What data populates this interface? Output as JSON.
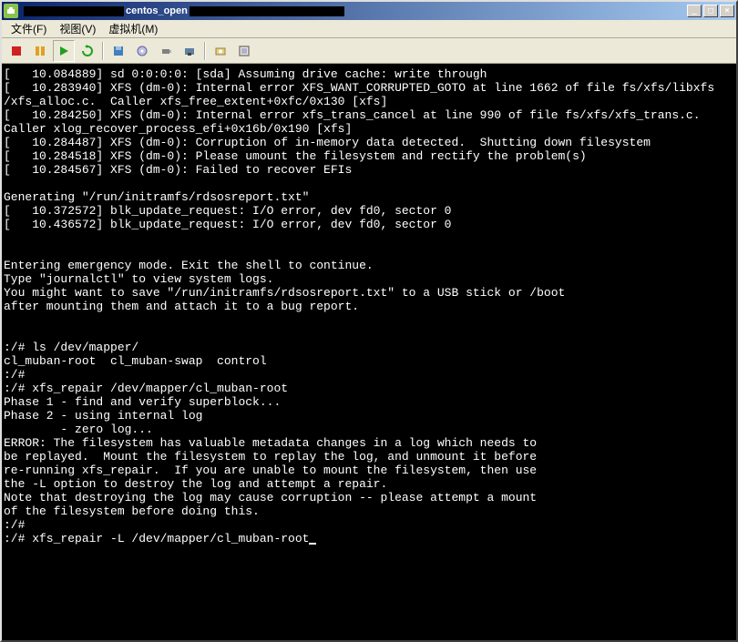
{
  "title": {
    "visible_fragment": "centos_open"
  },
  "winbtns": {
    "min": "_",
    "max": "□",
    "close": "×"
  },
  "menu": {
    "file": "文件(F)",
    "view": "视图(V)",
    "vm": "虚拟机(M)"
  },
  "toolbar_icons": {
    "stop": "stop-icon",
    "pause": "pause-icon",
    "play": "play-icon",
    "reset": "reset-icon",
    "floppy": "floppy-icon",
    "cd": "cd-icon",
    "usb": "usb-icon",
    "nic": "nic-icon",
    "snapshot": "snapshot-icon",
    "fullscreen": "fullscreen-icon"
  },
  "console_lines": [
    "[   10.084889] sd 0:0:0:0: [sda] Assuming drive cache: write through",
    "[   10.283940] XFS (dm-0): Internal error XFS_WANT_CORRUPTED_GOTO at line 1662 of file fs/xfs/libxfs",
    "/xfs_alloc.c.  Caller xfs_free_extent+0xfc/0x130 [xfs]",
    "[   10.284250] XFS (dm-0): Internal error xfs_trans_cancel at line 990 of file fs/xfs/xfs_trans.c.  ",
    "Caller xlog_recover_process_efi+0x16b/0x190 [xfs]",
    "[   10.284487] XFS (dm-0): Corruption of in-memory data detected.  Shutting down filesystem",
    "[   10.284518] XFS (dm-0): Please umount the filesystem and rectify the problem(s)",
    "[   10.284567] XFS (dm-0): Failed to recover EFIs",
    "",
    "Generating \"/run/initramfs/rdsosreport.txt\"",
    "[   10.372572] blk_update_request: I/O error, dev fd0, sector 0",
    "[   10.436572] blk_update_request: I/O error, dev fd0, sector 0",
    "",
    "",
    "Entering emergency mode. Exit the shell to continue.",
    "Type \"journalctl\" to view system logs.",
    "You might want to save \"/run/initramfs/rdsosreport.txt\" to a USB stick or /boot",
    "after mounting them and attach it to a bug report.",
    "",
    "",
    ":/# ls /dev/mapper/",
    "cl_muban-root  cl_muban-swap  control",
    ":/#",
    ":/# xfs_repair /dev/mapper/cl_muban-root",
    "Phase 1 - find and verify superblock...",
    "Phase 2 - using internal log",
    "        - zero log...",
    "ERROR: The filesystem has valuable metadata changes in a log which needs to",
    "be replayed.  Mount the filesystem to replay the log, and unmount it before",
    "re-running xfs_repair.  If you are unable to mount the filesystem, then use",
    "the -L option to destroy the log and attempt a repair.",
    "Note that destroying the log may cause corruption -- please attempt a mount",
    "of the filesystem before doing this.",
    ":/#",
    ":/# xfs_repair -L /dev/mapper/cl_muban-root"
  ]
}
